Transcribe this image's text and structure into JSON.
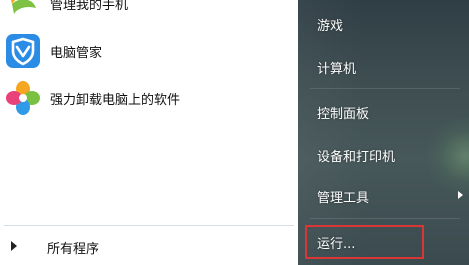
{
  "programs": [
    {
      "label": "管理我的手机",
      "icon": "phone-manager-icon"
    },
    {
      "label": "电脑管家",
      "icon": "pc-manager-shield-icon"
    },
    {
      "label": "强力卸载电脑上的软件",
      "icon": "uninstaller-clover-icon"
    }
  ],
  "all_programs": {
    "label": "所有程序",
    "icon": "right-arrow-icon"
  },
  "right_menu": {
    "items": [
      {
        "label": "游戏"
      },
      {
        "label": "计算机"
      },
      {
        "label": "控制面板"
      },
      {
        "label": "设备和打印机"
      },
      {
        "label": "管理工具",
        "has_submenu": true
      },
      {
        "label": "运行..."
      }
    ]
  },
  "colors": {
    "right_pane": "#3d4d50",
    "highlight": "#d93636"
  }
}
